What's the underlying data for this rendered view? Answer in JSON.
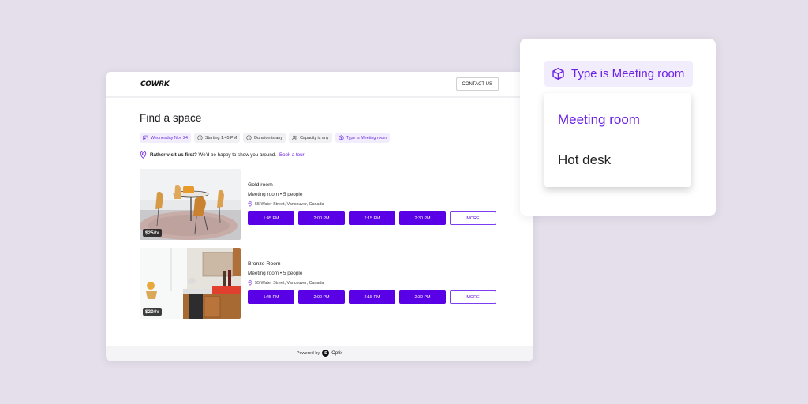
{
  "app": {
    "logo": "COWRK",
    "contact_label": "CONTACT US",
    "page_title": "Find a space",
    "filters": [
      {
        "icon": "calendar-icon",
        "label": "Wednesday Nov 24",
        "active": true
      },
      {
        "icon": "clock-icon",
        "label": "Starting 1:45 PM",
        "active": false
      },
      {
        "icon": "clock-icon",
        "label": "Duration is any",
        "active": false
      },
      {
        "icon": "people-icon",
        "label": "Capacity is any",
        "active": false
      },
      {
        "icon": "cube-icon",
        "label": "Type is Meeting room",
        "active": true
      }
    ],
    "tour": {
      "bold": "Rather visit us first?",
      "text": " We'd be happy to show you around.",
      "link": "Book a tour",
      "arrow": "→"
    },
    "listings": [
      {
        "name": "Gold room",
        "meta": "Meeting room • 5 people",
        "address": "55 Water Street, Vancouver, Canada",
        "price_amount": "$25",
        "price_unit": "/hr",
        "slots": [
          "1:45 PM",
          "2:00 PM",
          "2:15 PM",
          "2:30 PM"
        ],
        "more_label": "MORE"
      },
      {
        "name": "Bronze Room",
        "meta": "Meeting room • 5 people",
        "address": "55 Water Street, Vancouver, Canada",
        "price_amount": "$20",
        "price_unit": "/hr",
        "slots": [
          "1:45 PM",
          "2:00 PM",
          "2:15 PM",
          "2:30 PM"
        ],
        "more_label": "MORE"
      }
    ],
    "footer": {
      "powered_by": "Powered by",
      "brand_badge": "S",
      "brand": "Optix"
    }
  },
  "zoom_panel": {
    "chip_label": "Type is Meeting room",
    "options": [
      {
        "label": "Meeting room",
        "selected": true
      },
      {
        "label": "Hot desk",
        "selected": false
      }
    ]
  },
  "colors": {
    "accent": "#5a00e6",
    "accent_text": "#6b21e6",
    "chip_active_bg": "#f2edfd",
    "page_bg": "#e4dfea"
  }
}
